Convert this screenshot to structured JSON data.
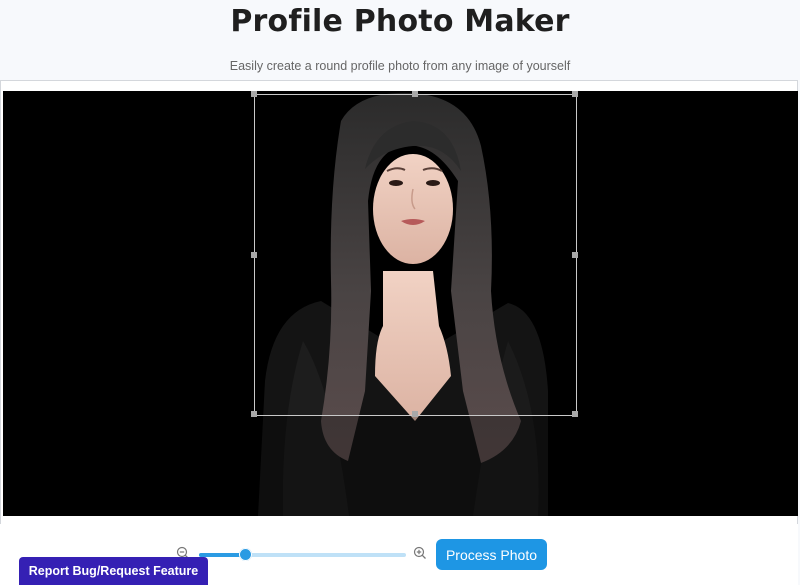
{
  "header": {
    "title": "Profile Photo Maker",
    "subtitle": "Easily create a round profile photo from any image of yourself"
  },
  "editor": {
    "photo_icon": "portrait-photo",
    "background_color": "#000000",
    "crop_box_color": "#c9c9c9"
  },
  "controls": {
    "zoom_out_icon": "zoom-out-icon",
    "zoom_in_icon": "zoom-in-icon",
    "zoom_level": 0.22,
    "process_label": "Process Photo",
    "accent_color": "#1e96e4"
  },
  "footer": {
    "report_label": "Report Bug/Request Feature",
    "report_color": "#3520b4"
  }
}
